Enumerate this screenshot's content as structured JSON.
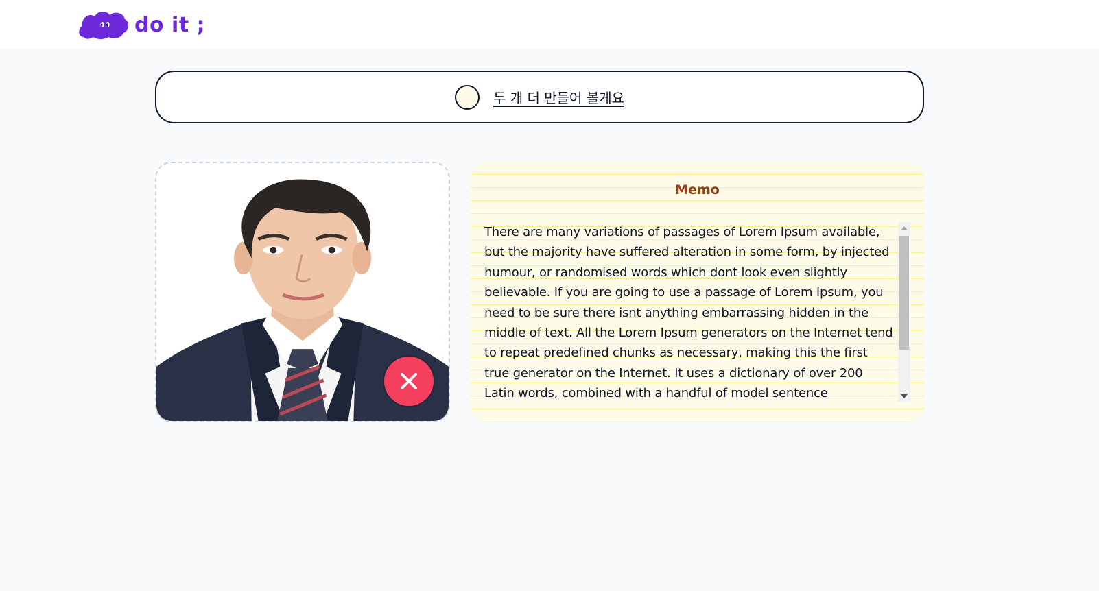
{
  "header": {
    "logo_text": "do it ;",
    "logo_icon": "purple-cloud-icon"
  },
  "todo": {
    "title": "두 개 더 만들어 볼게요",
    "completed": false
  },
  "image_card": {
    "delete_icon": "close-icon"
  },
  "memo": {
    "title": "Memo",
    "content": "There are many variations of passages of Lorem Ipsum available, but the majority have suffered alteration in some form, by injected humour, or randomised words which dont look even slightly believable. If you are going to use a passage of Lorem Ipsum, you need to be sure there isnt anything embarrassing hidden in the middle of text. All the Lorem Ipsum generators on the Internet tend to repeat predefined chunks as necessary, making this the first true generator on the Internet. It uses a dictionary of over 200 Latin words, combined with a handful of model sentence structures, to generate Lorem Ipsum which looks reasonable."
  },
  "colors": {
    "brand": "#6d28d9",
    "memo_bg": "#fefce8",
    "memo_title": "#92400e",
    "delete": "#f43f5e"
  }
}
